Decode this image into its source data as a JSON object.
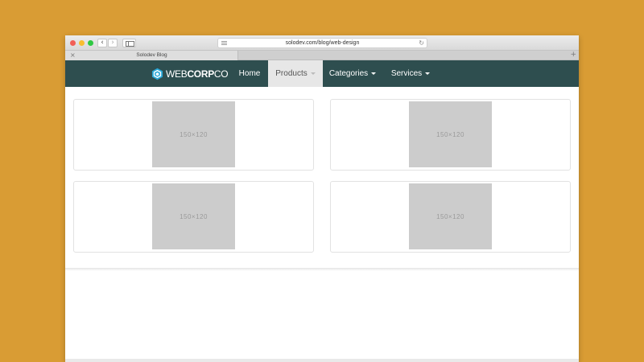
{
  "browser": {
    "url": "solodev.com/blog/web-design",
    "tab_title": "Solodev Blog",
    "back_glyph": "‹",
    "forward_glyph": "›",
    "reload_glyph": "↻",
    "tab_close_glyph": "×",
    "new_tab_glyph": "+"
  },
  "site": {
    "logo": {
      "light": "WEB",
      "bold": "CORP",
      "tail": "CO",
      "icon": "hexagon-logo-icon"
    },
    "nav": [
      {
        "label": "Home",
        "has_caret": false,
        "active": false
      },
      {
        "label": "Products",
        "has_caret": true,
        "active": true
      },
      {
        "label": "Categories",
        "has_caret": true,
        "active": false
      },
      {
        "label": "Services",
        "has_caret": true,
        "active": false
      }
    ],
    "cards": [
      {
        "placeholder": "150×120"
      },
      {
        "placeholder": "150×120"
      },
      {
        "placeholder": "150×120"
      },
      {
        "placeholder": "150×120"
      }
    ]
  },
  "colors": {
    "background": "#d99c34",
    "nav_bg": "#2e4e4f",
    "nav_active_bg": "#e7e7e7",
    "placeholder_bg": "#cccccc"
  }
}
